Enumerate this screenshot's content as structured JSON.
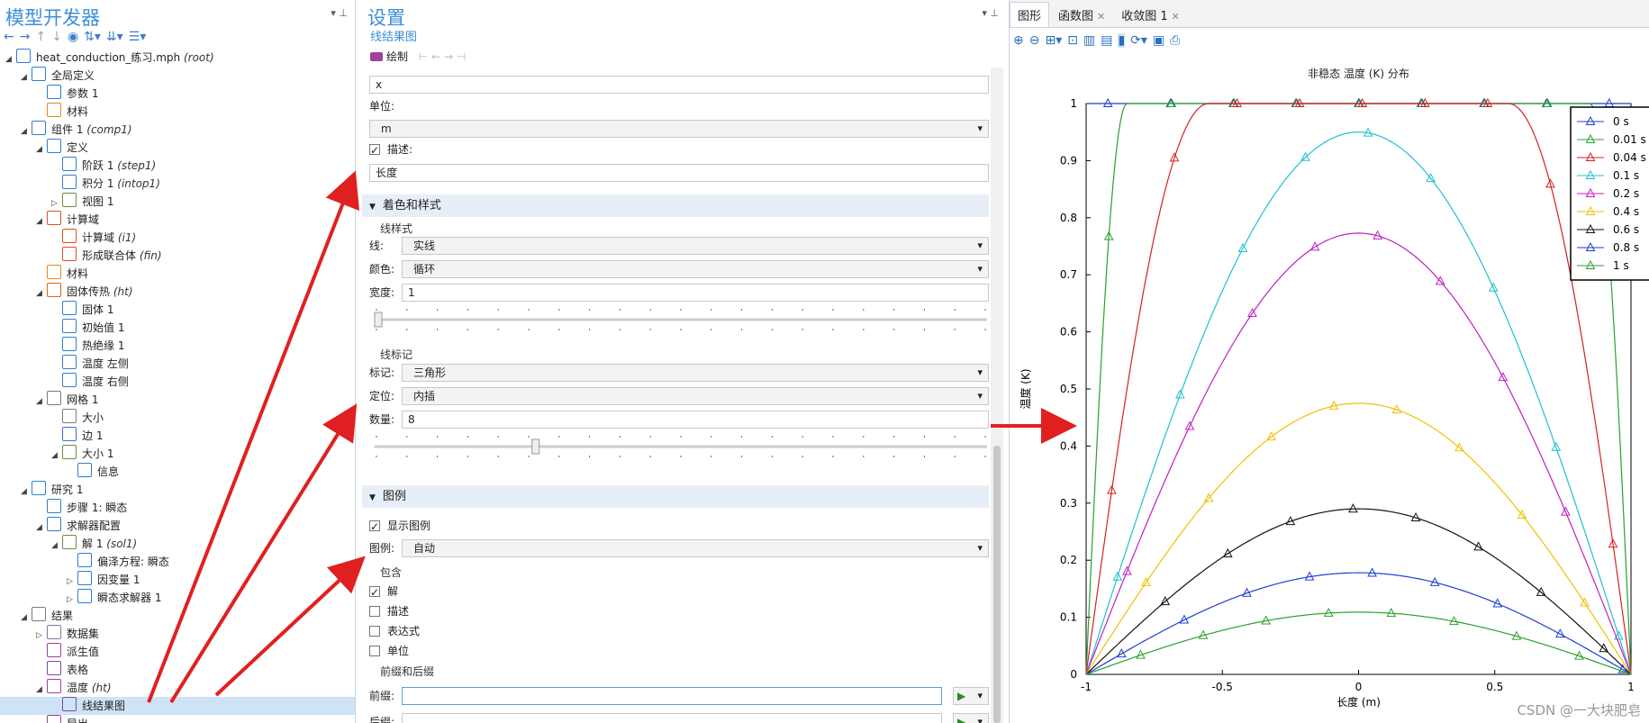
{
  "left_panel": {
    "title": "模型开发器",
    "tree": [
      {
        "label": "heat_conduction_练习.mph",
        "tag": "(root)",
        "depth": 0,
        "open": true,
        "icon": "model-icon",
        "color": "#2f7fd0"
      },
      {
        "label": "全局定义",
        "tag": "",
        "depth": 1,
        "open": true,
        "icon": "globe-icon",
        "color": "#2f7fd0"
      },
      {
        "label": "参数 1",
        "tag": "",
        "depth": 2,
        "open": null,
        "icon": "parameters-icon",
        "color": "#2f7fd0"
      },
      {
        "label": "材料",
        "tag": "",
        "depth": 2,
        "open": null,
        "icon": "materials-icon",
        "color": "#e08a20"
      },
      {
        "label": "组件 1",
        "tag": "(comp1)",
        "depth": 1,
        "open": true,
        "icon": "component-icon",
        "color": "#2f7fd0"
      },
      {
        "label": "定义",
        "tag": "",
        "depth": 2,
        "open": true,
        "icon": "definitions-icon",
        "color": "#2f7fd0"
      },
      {
        "label": "阶跃 1",
        "tag": "(step1)",
        "depth": 3,
        "open": null,
        "icon": "step-icon",
        "color": "#2f7fd0"
      },
      {
        "label": "积分 1",
        "tag": "(intop1)",
        "depth": 3,
        "open": null,
        "icon": "integral-icon",
        "color": "#2f7fd0"
      },
      {
        "label": "视图 1",
        "tag": "",
        "depth": 3,
        "open": false,
        "icon": "view-icon",
        "color": "#6a8f3a"
      },
      {
        "label": "计算域",
        "tag": "",
        "depth": 2,
        "open": true,
        "icon": "geometry-icon",
        "color": "#e05020"
      },
      {
        "label": "计算域",
        "tag": "(i1)",
        "depth": 3,
        "open": null,
        "icon": "interval-icon",
        "color": "#e05020"
      },
      {
        "label": "形成联合体",
        "tag": "(fin)",
        "depth": 3,
        "open": null,
        "icon": "union-icon",
        "color": "#e05020"
      },
      {
        "label": "材料",
        "tag": "",
        "depth": 2,
        "open": null,
        "icon": "materials-icon",
        "color": "#e08a20"
      },
      {
        "label": "固体传热",
        "tag": "(ht)",
        "depth": 2,
        "open": true,
        "icon": "heat-transfer-icon",
        "color": "#e06020"
      },
      {
        "label": "固体 1",
        "tag": "",
        "depth": 3,
        "open": null,
        "icon": "solid-icon",
        "color": "#2f7fd0"
      },
      {
        "label": "初始值 1",
        "tag": "",
        "depth": 3,
        "open": null,
        "icon": "initial-values-icon",
        "color": "#2f7fd0"
      },
      {
        "label": "热绝缘 1",
        "tag": "",
        "depth": 3,
        "open": null,
        "icon": "insulation-icon",
        "color": "#2f7fd0"
      },
      {
        "label": "温度 左侧",
        "tag": "",
        "depth": 3,
        "open": null,
        "icon": "temperature-icon",
        "color": "#2f7fd0"
      },
      {
        "label": "温度 右侧",
        "tag": "",
        "depth": 3,
        "open": null,
        "icon": "temperature-icon",
        "color": "#2f7fd0"
      },
      {
        "label": "网格 1",
        "tag": "",
        "depth": 2,
        "open": true,
        "icon": "mesh-icon",
        "color": "#7a7a7a"
      },
      {
        "label": "大小",
        "tag": "",
        "depth": 3,
        "open": null,
        "icon": "size-icon",
        "color": "#7a7a7a"
      },
      {
        "label": "边 1",
        "tag": "",
        "depth": 3,
        "open": null,
        "icon": "edge-icon",
        "color": "#3c6fd0"
      },
      {
        "label": "大小 1",
        "tag": "",
        "depth": 3,
        "open": true,
        "icon": "size-icon",
        "color": "#6a8f3a"
      },
      {
        "label": "信息",
        "tag": "",
        "depth": 4,
        "open": null,
        "icon": "info-icon",
        "color": "#2f7fd0"
      },
      {
        "label": "研究 1",
        "tag": "",
        "depth": 1,
        "open": true,
        "icon": "study-icon",
        "color": "#2f7fd0"
      },
      {
        "label": "步骤 1: 瞬态",
        "tag": "",
        "depth": 2,
        "open": null,
        "icon": "time-step-icon",
        "color": "#2f7fd0"
      },
      {
        "label": "求解器配置",
        "tag": "",
        "depth": 2,
        "open": true,
        "icon": "solver-config-icon",
        "color": "#2f7fd0"
      },
      {
        "label": "解 1",
        "tag": "(sol1)",
        "depth": 3,
        "open": true,
        "icon": "solution-icon",
        "color": "#6a8f3a"
      },
      {
        "label": "偏泽方程: 瞬态",
        "tag": "",
        "depth": 4,
        "open": null,
        "icon": "compile-icon",
        "color": "#2f7fd0"
      },
      {
        "label": "因变量 1",
        "tag": "",
        "depth": 4,
        "open": false,
        "icon": "dependent-vars-icon",
        "color": "#2f7fd0"
      },
      {
        "label": "瞬态求解器 1",
        "tag": "",
        "depth": 4,
        "open": false,
        "icon": "time-solver-icon",
        "color": "#2f7fd0"
      },
      {
        "label": "结果",
        "tag": "",
        "depth": 1,
        "open": true,
        "icon": "results-icon",
        "color": "#7a7a7a"
      },
      {
        "label": "数据集",
        "tag": "",
        "depth": 2,
        "open": false,
        "icon": "datasets-icon",
        "color": "#7a7aa0"
      },
      {
        "label": "派生值",
        "tag": "",
        "depth": 2,
        "open": null,
        "icon": "derived-values-icon",
        "color": "#a040a0"
      },
      {
        "label": "表格",
        "tag": "",
        "depth": 2,
        "open": null,
        "icon": "table-icon",
        "color": "#7a4ab0"
      },
      {
        "label": "温度",
        "tag": "(ht)",
        "depth": 2,
        "open": true,
        "icon": "plot-group-icon",
        "color": "#a040a0"
      },
      {
        "label": "线结果图",
        "tag": "",
        "depth": 3,
        "open": null,
        "icon": "line-graph-icon",
        "color": "#7a4ab0",
        "selected": true
      },
      {
        "label": "导出",
        "tag": "",
        "depth": 2,
        "open": null,
        "icon": "export-icon",
        "color": "#a040a0"
      }
    ]
  },
  "settings": {
    "title": "设置",
    "subtitle": "线结果图",
    "plot_button": "绘制",
    "expr_value": "x",
    "unit_label": "单位:",
    "unit_value": "m",
    "desc_label": "描述:",
    "desc_value": "长度",
    "section_coloring": "着色和样式",
    "group_linestyle": "线样式",
    "line_label": "线:",
    "line_value": "实线",
    "color_label": "颜色:",
    "color_value": "循环",
    "width_label": "宽度:",
    "width_value": "1",
    "width_slider": 0,
    "group_markers": "线标记",
    "marker_label": "标记:",
    "marker_value": "三角形",
    "position_label": "定位:",
    "position_value": "内插",
    "count_label": "数量:",
    "count_value": "8",
    "count_slider": 0.26,
    "section_legend": "图例",
    "show_legend": "显示图例",
    "legend_label": "图例:",
    "legend_value": "自动",
    "group_include": "包含",
    "inc_solution": "解",
    "inc_description": "描述",
    "inc_expression": "表达式",
    "inc_unit": "单位",
    "group_prefix": "前缀和后缀",
    "prefix_label": "前缀:",
    "suffix_label": "后缀:"
  },
  "graphics": {
    "tabs": [
      {
        "label": "图形",
        "closable": false,
        "active": true
      },
      {
        "label": "函数图",
        "closable": true,
        "active": false
      },
      {
        "label": "收敛图 1",
        "closable": true,
        "active": false
      }
    ],
    "watermark": "CSDN @一大块肥皂"
  },
  "chart_data": {
    "type": "line",
    "title": "非稳态 温度 (K) 分布",
    "xlabel": "长度 (m)",
    "ylabel": "温度 (K)",
    "xlim": [
      -1,
      1
    ],
    "ylim": [
      0,
      1
    ],
    "xticks": [
      "-1",
      "-0.5",
      "0",
      "0.5",
      "1"
    ],
    "yticks": [
      "0",
      "0.1",
      "0.2",
      "0.3",
      "0.4",
      "0.5",
      "0.6",
      "0.7",
      "0.8",
      "0.9",
      "1"
    ],
    "marker": "triangle",
    "legend_position": "top-right",
    "series": [
      {
        "name": "0 s",
        "color": "#1f3fd0",
        "peak": 1.0,
        "k": 0
      },
      {
        "name": "0.01 s",
        "color": "#2ca02c",
        "peak": 1.0,
        "k": 0.01
      },
      {
        "name": "0.04 s",
        "color": "#d62020",
        "peak": 1.0,
        "k": 0.04
      },
      {
        "name": "0.1 s",
        "color": "#20c0d0",
        "peak": 0.95,
        "k": 0.1
      },
      {
        "name": "0.2 s",
        "color": "#c020c0",
        "peak": 0.773,
        "k": 0.2
      },
      {
        "name": "0.4 s",
        "color": "#f0c000",
        "peak": 0.475,
        "k": 0.4
      },
      {
        "name": "0.6 s",
        "color": "#111111",
        "peak": 0.29,
        "k": 0.6
      },
      {
        "name": "0.8 s",
        "color": "#1f3fd0",
        "peak": 0.178,
        "k": 0.8
      },
      {
        "name": "1 s",
        "color": "#2ca02c",
        "peak": 0.109,
        "k": 1
      }
    ]
  }
}
